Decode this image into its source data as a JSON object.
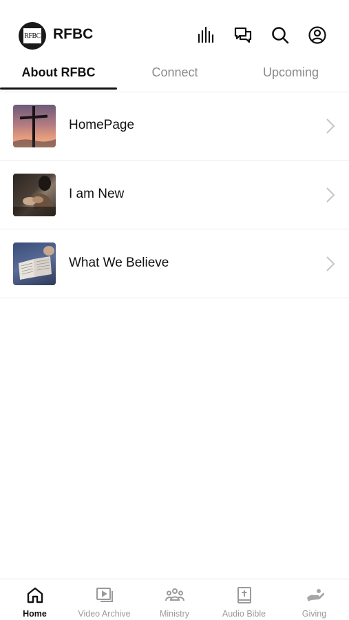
{
  "header": {
    "title": "RFBC",
    "logo_text": "RFBC",
    "icons": [
      "audio-bars-icon",
      "chat-icon",
      "search-icon",
      "profile-icon"
    ]
  },
  "tabs": [
    {
      "label": "About RFBC",
      "active": true
    },
    {
      "label": "Connect",
      "active": false
    },
    {
      "label": "Upcoming",
      "active": false
    }
  ],
  "list": {
    "items": [
      {
        "label": "HomePage",
        "thumbnail": "cross-sunset-image"
      },
      {
        "label": "I am New",
        "thumbnail": "people-greeting-image"
      },
      {
        "label": "What We Believe",
        "thumbnail": "open-bible-image"
      }
    ]
  },
  "tabbar": {
    "items": [
      {
        "label": "Home",
        "icon": "home-icon",
        "active": true
      },
      {
        "label": "Video Archive",
        "icon": "video-archive-icon",
        "active": false
      },
      {
        "label": "Ministry",
        "icon": "ministry-icon",
        "active": false
      },
      {
        "label": "Audio Bible",
        "icon": "audio-bible-icon",
        "active": false
      },
      {
        "label": "Giving",
        "icon": "giving-icon",
        "active": false
      }
    ]
  },
  "colors": {
    "text": "#111111",
    "muted": "#8a8a8a",
    "divider": "#ececec",
    "active_indicator": "#111111"
  }
}
